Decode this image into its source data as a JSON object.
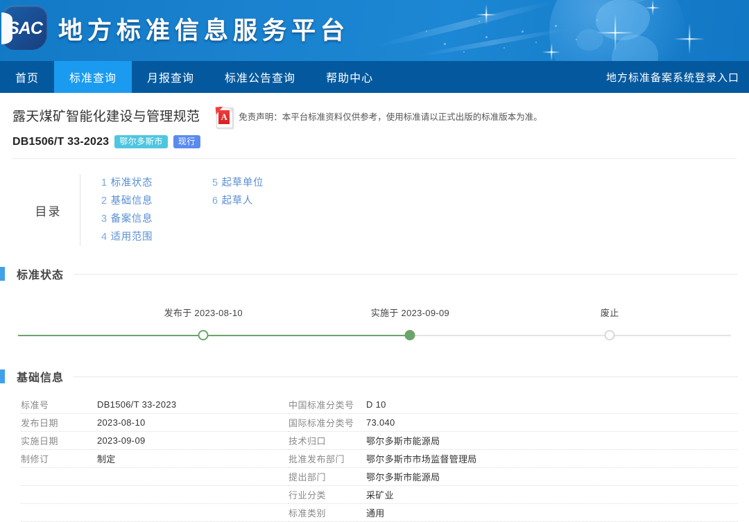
{
  "header": {
    "logo_text": "SAC",
    "site_title": "地方标准信息服务平台"
  },
  "nav": {
    "items": [
      {
        "label": "首页",
        "active": false
      },
      {
        "label": "标准查询",
        "active": true
      },
      {
        "label": "月报查询",
        "active": false
      },
      {
        "label": "标准公告查询",
        "active": false
      },
      {
        "label": "帮助中心",
        "active": false
      }
    ],
    "right_link": "地方标准备案系统登录入口"
  },
  "standard": {
    "title": "露天煤矿智能化建设与管理规范",
    "code": "DB1506/T 33-2023",
    "badges": [
      {
        "label": "鄂尔多斯市",
        "color": "#4fc6e0"
      },
      {
        "label": "现行",
        "color": "#5b8bef"
      }
    ],
    "disclaimer": "免责声明：本平台标准资料仅供参考，使用标准请以正式出版的标准版本为准。",
    "pdf_icon_letter": "A"
  },
  "toc": {
    "label": "目录",
    "columns": [
      [
        {
          "num": "1",
          "label": "标准状态"
        },
        {
          "num": "2",
          "label": "基础信息"
        },
        {
          "num": "3",
          "label": "备案信息"
        },
        {
          "num": "4",
          "label": "适用范围"
        }
      ],
      [
        {
          "num": "5",
          "label": "起草单位"
        },
        {
          "num": "6",
          "label": "起草人"
        }
      ]
    ]
  },
  "status_section": {
    "title": "标准状态",
    "timeline": {
      "progress_percent": 55,
      "nodes": [
        {
          "label": "发布于 2023-08-10",
          "position_percent": 26,
          "state": "hollow-green"
        },
        {
          "label": "实施于 2023-09-09",
          "position_percent": 55,
          "state": "filled-green"
        },
        {
          "label": "废止",
          "position_percent": 83,
          "state": "hollow-gray"
        }
      ]
    }
  },
  "basic_section": {
    "title": "基础信息",
    "left_rows": [
      {
        "label": "标准号",
        "value": "DB1506/T 33-2023"
      },
      {
        "label": "发布日期",
        "value": "2023-08-10"
      },
      {
        "label": "实施日期",
        "value": "2023-09-09"
      },
      {
        "label": "制修订",
        "value": "制定"
      },
      {
        "label": "",
        "value": ""
      },
      {
        "label": "",
        "value": ""
      },
      {
        "label": "",
        "value": ""
      }
    ],
    "right_rows": [
      {
        "label": "中国标准分类号",
        "value": "D 10"
      },
      {
        "label": "国际标准分类号",
        "value": "73.040"
      },
      {
        "label": "技术归口",
        "value": "鄂尔多斯市能源局"
      },
      {
        "label": "批准发布部门",
        "value": "鄂尔多斯市市场监督管理局"
      },
      {
        "label": "提出部门",
        "value": "鄂尔多斯市能源局"
      },
      {
        "label": "行业分类",
        "value": "采矿业"
      },
      {
        "label": "标准类别",
        "value": "通用"
      }
    ]
  }
}
